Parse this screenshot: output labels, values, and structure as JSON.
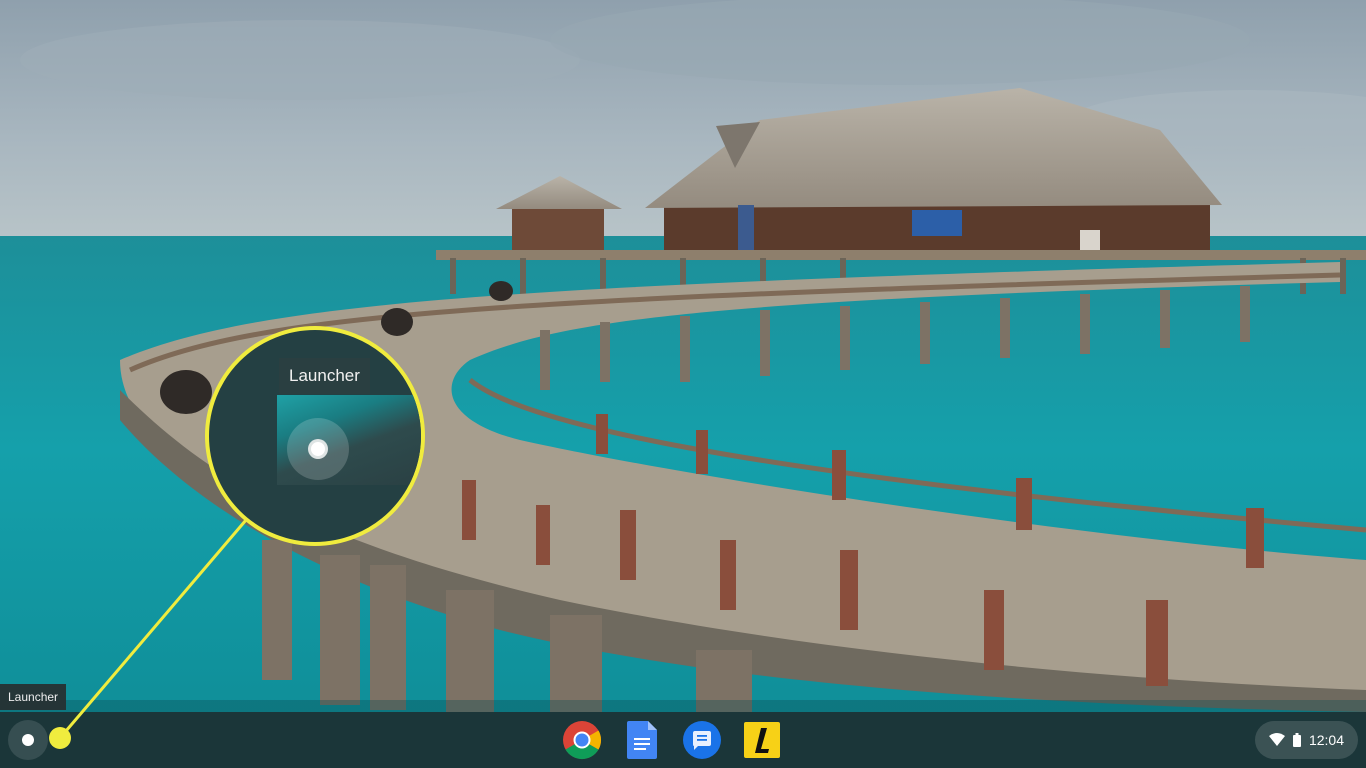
{
  "callout": {
    "tooltip_label": "Launcher",
    "highlight_color": "#f0ec3e"
  },
  "shelf": {
    "launcher_tooltip": "Launcher",
    "apps": [
      {
        "name": "Chrome",
        "icon": "chrome-icon"
      },
      {
        "name": "Google Docs",
        "icon": "docs-icon"
      },
      {
        "name": "Messages",
        "icon": "messages-icon"
      },
      {
        "name": "Lexicon",
        "icon": "l-app-icon"
      }
    ],
    "status": {
      "time": "12:04",
      "icons": [
        "wifi-icon",
        "battery-icon"
      ]
    }
  }
}
